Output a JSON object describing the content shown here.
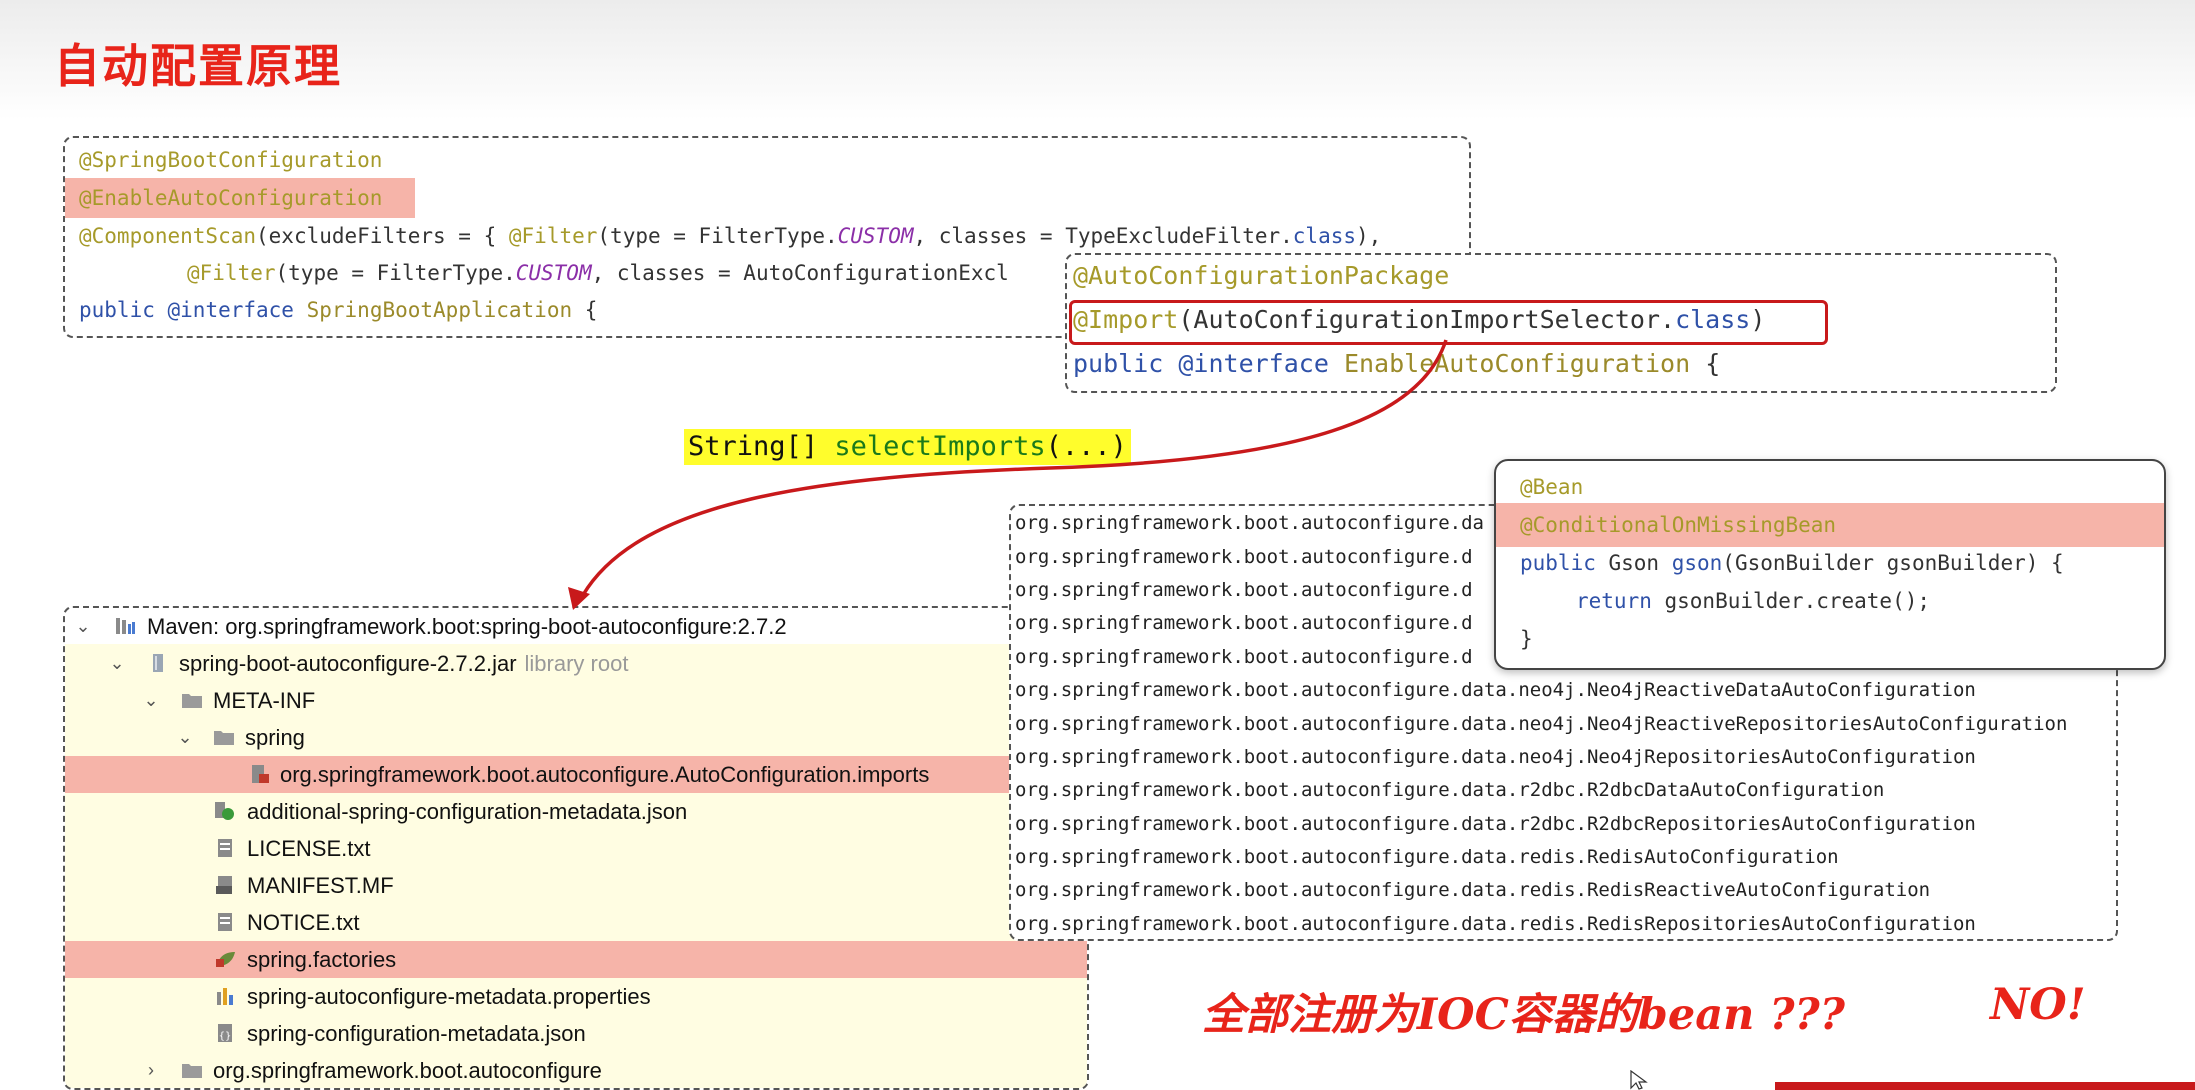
{
  "title": "自动配置原理",
  "box1": {
    "l1": "@SpringBootConfiguration",
    "l2": "@EnableAutoConfiguration",
    "l3_ann": "@ComponentScan",
    "l3_a": "(excludeFilters = { ",
    "l3_filter": "@Filter",
    "l3_b": "(type = FilterType.",
    "l3_custom": "CUSTOM",
    "l3_c": ", classes = TypeExcludeFilter.",
    "l3_class": "class",
    "l3_d": "),",
    "l4_filter": "@Filter",
    "l4_b": "(type = FilterType.",
    "l4_custom": "CUSTOM",
    "l4_c": ", classes = AutoConfigurationExcl",
    "l5_public": "public",
    "l5_iface": "@interface",
    "l5_name": "SpringBootApplication",
    "l5_brace": " {"
  },
  "box2": {
    "l1": "@AutoConfigurationPackage",
    "l2_ann": "@Import",
    "l2_a": "(AutoConfigurationImportSelector.",
    "l2_class": "class",
    "l2_b": ")",
    "l3_public": "public",
    "l3_iface": "@interface",
    "l3_name": "EnableAutoConfiguration",
    "l3_brace": " {"
  },
  "select_imports": {
    "type": "String[] ",
    "method": "selectImports",
    "args": "(...)"
  },
  "tree": {
    "rows": [
      {
        "label": "Maven: org.springframework.boot:spring-boot-autoconfigure:2.7.2"
      },
      {
        "label": "spring-boot-autoconfigure-2.7.2.jar",
        "extra": "library root"
      },
      {
        "label": "META-INF"
      },
      {
        "label": "spring"
      },
      {
        "label": "org.springframework.boot.autoconfigure.AutoConfiguration.imports"
      },
      {
        "label": "additional-spring-configuration-metadata.json"
      },
      {
        "label": "LICENSE.txt"
      },
      {
        "label": "MANIFEST.MF"
      },
      {
        "label": "NOTICE.txt"
      },
      {
        "label": "spring.factories"
      },
      {
        "label": "spring-autoconfigure-metadata.properties"
      },
      {
        "label": "spring-configuration-metadata.json"
      },
      {
        "label": "org.springframework.boot.autoconfigure"
      }
    ]
  },
  "list": {
    "lines": [
      "org.springframework.boot.autoconfigure.da",
      "org.springframework.boot.autoconfigure.d",
      "org.springframework.boot.autoconfigure.d",
      "org.springframework.boot.autoconfigure.d",
      "org.springframework.boot.autoconfigure.d",
      "org.springframework.boot.autoconfigure.data.neo4j.Neo4jReactiveDataAutoConfiguration",
      "org.springframework.boot.autoconfigure.data.neo4j.Neo4jReactiveRepositoriesAutoConfiguration",
      "org.springframework.boot.autoconfigure.data.neo4j.Neo4jRepositoriesAutoConfiguration",
      "org.springframework.boot.autoconfigure.data.r2dbc.R2dbcDataAutoConfiguration",
      "org.springframework.boot.autoconfigure.data.r2dbc.R2dbcRepositoriesAutoConfiguration",
      "org.springframework.boot.autoconfigure.data.redis.RedisAutoConfiguration",
      "org.springframework.boot.autoconfigure.data.redis.RedisReactiveAutoConfiguration",
      "org.springframework.boot.autoconfigure.data.redis.RedisRepositoriesAutoConfiguration"
    ]
  },
  "bean_box": {
    "l1": "@Bean",
    "l2": "@ConditionalOnMissingBean",
    "l3_public": "public",
    "l3_type": " Gson ",
    "l3_method": "gson",
    "l3_rest": "(GsonBuilder gsonBuilder) {",
    "l4_return": "return",
    "l4_rest": " gsonBuilder.create();",
    "l5": "}"
  },
  "bottom_text": "全部注册为IOC容器的bean ???",
  "no_text": "NO!",
  "colors": {
    "title": "#e8241a",
    "annotation": "#a69a2a",
    "keyword": "#2f51a8",
    "highlight": "#f6b4a9",
    "frame_red": "#c8191b",
    "yellow": "#fffd2c"
  }
}
